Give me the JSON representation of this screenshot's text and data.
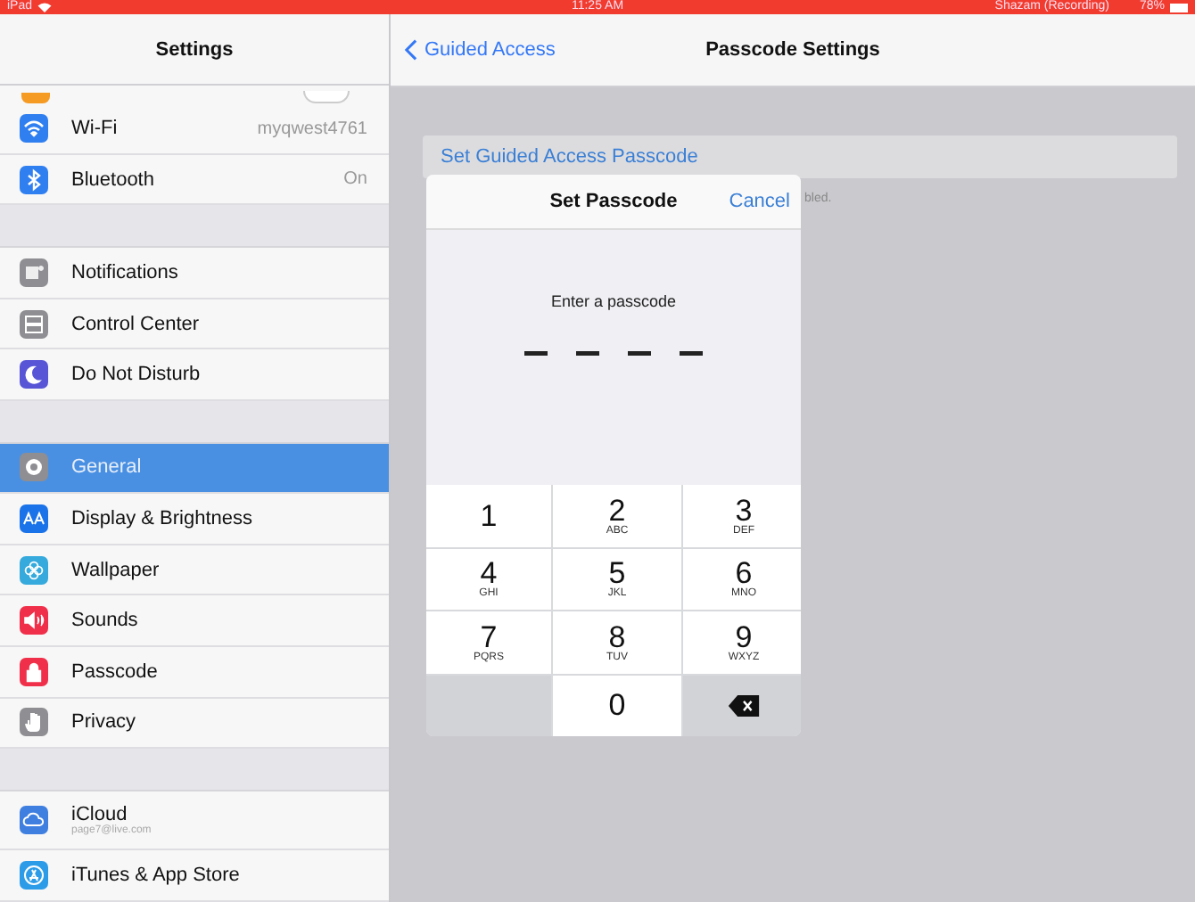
{
  "status_bar": {
    "device": "iPad",
    "time": "11:25 AM",
    "recording": "Shazam (Recording)",
    "battery": "78%"
  },
  "sidebar": {
    "title": "Settings",
    "partial_row": {
      "on": false
    },
    "sections": [
      {
        "items": [
          {
            "label": "Wi-Fi",
            "value": "myqwest4761",
            "kind": "wifi",
            "color": "#2f7ff0",
            "selected": false
          },
          {
            "label": "Bluetooth",
            "value": "On",
            "kind": "bluetooth",
            "color": "#2f7ff0",
            "selected": false
          }
        ]
      },
      {
        "items": [
          {
            "label": "Notifications",
            "kind": "notifications",
            "color": "#8e8e93",
            "selected": false
          },
          {
            "label": "Control Center",
            "kind": "control",
            "color": "#8e8e93",
            "selected": false
          },
          {
            "label": "Do Not Disturb",
            "kind": "moon",
            "color": "#5856d6",
            "selected": false
          }
        ]
      },
      {
        "items": [
          {
            "label": "General",
            "kind": "gear",
            "color": "#8e8e93",
            "selected": true
          },
          {
            "label": "Display & Brightness",
            "kind": "text",
            "color": "#1a73e8",
            "selected": false
          },
          {
            "label": "Wallpaper",
            "kind": "flower",
            "color": "#36aadc",
            "selected": false
          },
          {
            "label": "Sounds",
            "kind": "speaker",
            "color": "#f0304a",
            "selected": false
          },
          {
            "label": "Passcode",
            "kind": "lock",
            "color": "#f0304a",
            "selected": false
          },
          {
            "label": "Privacy",
            "kind": "hand",
            "color": "#8e8e93",
            "selected": false
          }
        ]
      },
      {
        "items": [
          {
            "label": "iCloud",
            "sublabel": "page7@live.com",
            "kind": "cloud",
            "color": "#3f7fe0",
            "selected": false
          },
          {
            "label": "iTunes & App Store",
            "kind": "appstore",
            "color": "#2d9ce8",
            "selected": false
          }
        ]
      }
    ]
  },
  "nav": {
    "back": "Guided Access",
    "title": "Passcode Settings"
  },
  "content": {
    "row": "Set Guided Access Passcode",
    "footer_fragment": "bled."
  },
  "dialog": {
    "title": "Set Passcode",
    "cancel": "Cancel",
    "prompt": "Enter a passcode",
    "keys": [
      {
        "kind": "digit",
        "digit": "1"
      },
      {
        "kind": "digit",
        "digit": "2",
        "letters": "ABC"
      },
      {
        "kind": "digit",
        "digit": "3",
        "letters": "DEF"
      },
      {
        "kind": "digit",
        "digit": "4",
        "letters": "GHI"
      },
      {
        "kind": "digit",
        "digit": "5",
        "letters": "JKL"
      },
      {
        "kind": "digit",
        "digit": "6",
        "letters": "MNO"
      },
      {
        "kind": "digit",
        "digit": "7",
        "letters": "PQRS"
      },
      {
        "kind": "digit",
        "digit": "8",
        "letters": "TUV"
      },
      {
        "kind": "digit",
        "digit": "9",
        "letters": "WXYZ"
      },
      {
        "kind": "blank"
      },
      {
        "kind": "digit",
        "digit": "0"
      },
      {
        "kind": "delete"
      }
    ]
  }
}
